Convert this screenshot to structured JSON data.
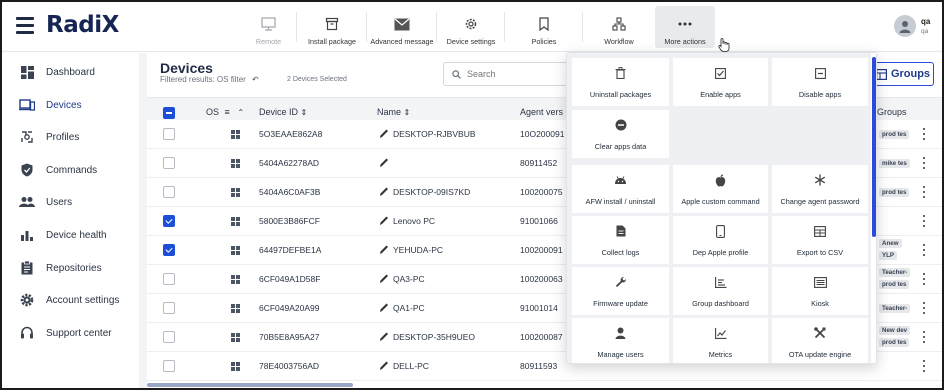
{
  "app": {
    "logo": "RadiX"
  },
  "toolbar": [
    {
      "label": "Remote",
      "icon": "monitor-icon",
      "disabled": true
    },
    {
      "label": "Install package",
      "icon": "package-icon",
      "disabled": false
    },
    {
      "label": "Advanced message",
      "icon": "envelope-icon",
      "disabled": false
    },
    {
      "label": "Device settings",
      "icon": "gear-icon",
      "disabled": false
    },
    {
      "label": "Policies",
      "icon": "bookmark-icon",
      "disabled": false
    },
    {
      "label": "Workflow",
      "icon": "workflow-icon",
      "disabled": false
    },
    {
      "label": "More actions",
      "icon": "more-dots-icon",
      "disabled": false,
      "active": true
    }
  ],
  "user": {
    "name": "qa",
    "sub": "qa"
  },
  "sidebar": {
    "items": [
      {
        "label": "Dashboard",
        "icon": "dashboard-icon"
      },
      {
        "label": "Devices",
        "icon": "devices-icon",
        "active": true
      },
      {
        "label": "Profiles",
        "icon": "profiles-icon"
      },
      {
        "label": "Commands",
        "icon": "shield-icon"
      },
      {
        "label": "Users",
        "icon": "users-icon"
      },
      {
        "label": "Device health",
        "icon": "bar-chart-icon"
      },
      {
        "label": "Repositories",
        "icon": "clipboard-icon"
      },
      {
        "label": "Account settings",
        "icon": "gear-icon"
      },
      {
        "label": "Support center",
        "icon": "headset-icon"
      }
    ]
  },
  "page": {
    "title": "Devices",
    "filter_text": "Filtered results: OS filter",
    "selected_text": "2 Devices Selected",
    "search_placeholder": "Search",
    "groups_button": "Groups"
  },
  "table": {
    "columns": {
      "os": "OS",
      "device_id": "Device ID",
      "name": "Name",
      "agent": "Agent vers",
      "groups": "Groups"
    },
    "rows": [
      {
        "device_id": "5O3EAAE862A8",
        "name": "DESKTOP-RJBVBUB",
        "agent": "10O200091",
        "checked": false,
        "tags": [
          "prod tes"
        ]
      },
      {
        "device_id": "5404A62278AD",
        "name": "",
        "agent": "80911452",
        "checked": false,
        "tags": [
          "mike tes"
        ]
      },
      {
        "device_id": "5404A6C0AF3B",
        "name": "DESKTOP-09IS7KD",
        "agent": "100200075",
        "checked": false,
        "tags": [
          "prod tes"
        ]
      },
      {
        "device_id": "5800E3B86FCF",
        "name": "Lenovo PC",
        "agent": "91001066",
        "checked": true,
        "tags": []
      },
      {
        "device_id": "64497DEFBE1A",
        "name": "YEHUDA-PC",
        "agent": "100200091",
        "checked": true,
        "tags": [
          "Anew",
          "YLP"
        ]
      },
      {
        "device_id": "6CF049A1D58F",
        "name": "QA3-PC",
        "agent": "100200063",
        "checked": false,
        "tags": [
          "Teacher-",
          "prod tes"
        ]
      },
      {
        "device_id": "6CF049A20A99",
        "name": "QA1-PC",
        "agent": "91001014",
        "checked": false,
        "tags": [
          "Teacher-"
        ]
      },
      {
        "device_id": "70B5E8A95A27",
        "name": "DESKTOP-35H9UEO",
        "agent": "100200087",
        "checked": false,
        "tags": [
          "New dev",
          "prod tes"
        ]
      },
      {
        "device_id": "78E4003756AD",
        "name": "DELL-PC",
        "agent": "80911593",
        "checked": false,
        "tags": []
      }
    ]
  },
  "more_actions_menu": {
    "items": [
      {
        "label": "Uninstall packages",
        "icon": "trash-icon"
      },
      {
        "label": "Enable apps",
        "icon": "checkbox-icon"
      },
      {
        "label": "Disable apps",
        "icon": "minus-box-icon"
      },
      {
        "label": "Clear apps data",
        "icon": "minus-circle-icon"
      },
      {
        "label": "AFW install / uninstall",
        "icon": "android-icon"
      },
      {
        "label": "Apple custom command",
        "icon": "apple-icon"
      },
      {
        "label": "Change agent password",
        "icon": "asterisk-icon"
      },
      {
        "label": "Collect logs",
        "icon": "file-icon"
      },
      {
        "label": "Dep Apple profile",
        "icon": "phone-icon"
      },
      {
        "label": "Export to CSV",
        "icon": "table-icon"
      },
      {
        "label": "Firmware update",
        "icon": "wrench-icon"
      },
      {
        "label": "Group dashboard",
        "icon": "dashboard-chart-icon"
      },
      {
        "label": "Kiosk",
        "icon": "kiosk-icon"
      },
      {
        "label": "Manage users",
        "icon": "user-icon"
      },
      {
        "label": "Metrics",
        "icon": "line-chart-icon"
      },
      {
        "label": "OTA update engine",
        "icon": "tools-icon"
      }
    ]
  }
}
